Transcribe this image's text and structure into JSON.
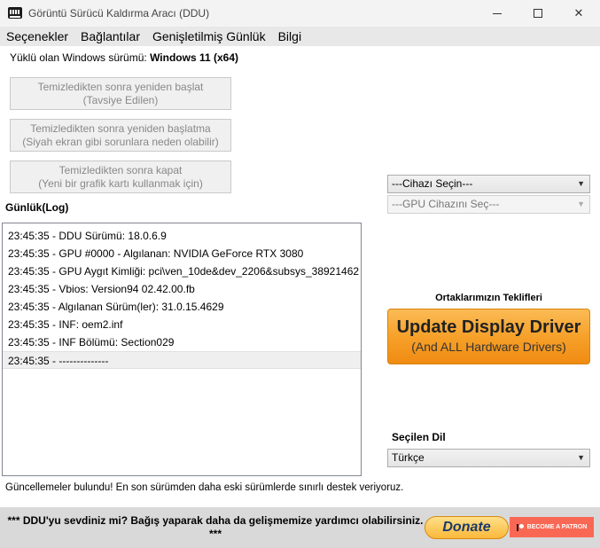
{
  "window": {
    "title": "Görüntü Sürücü Kaldırma Aracı (DDU)",
    "minimize_label": "",
    "maximize_label": "",
    "close_label": "✕"
  },
  "menu": [
    "Seçenekler",
    "Bağlantılar",
    "Genişletilmiş Günlük",
    "Bilgi"
  ],
  "os_info": {
    "label": "Yüklü olan Windows sürümü: ",
    "value": "Windows 11 (x64)"
  },
  "actions": [
    {
      "line1": "Temizledikten sonra yeniden başlat",
      "line2": "(Tavsiye Edilen)"
    },
    {
      "line1": "Temizledikten sonra yeniden başlatma",
      "line2": "(Siyah ekran gibi sorunlara neden olabilir)"
    },
    {
      "line1": "Temizledikten sonra kapat",
      "line2": "(Yeni bir grafik kartı kullanmak için)"
    }
  ],
  "log": {
    "title": "Günlük(Log)",
    "entries": [
      "23:45:35 - DDU Sürümü: 18.0.6.9",
      "23:45:35 - GPU #0000 - Algılanan: NVIDIA GeForce RTX 3080",
      "23:45:35 - GPU Aygıt Kimliği: pci\\ven_10de&dev_2206&subsys_38921462",
      "23:45:35 - Vbios: Version94 02.42.00.fb",
      "23:45:35 - Algılanan Sürüm(ler): 31.0.15.4629",
      "23:45:35 - INF: oem2.inf",
      "23:45:35 - INF Bölümü: Section029",
      "23:45:35 - --------------"
    ]
  },
  "device_select": {
    "value": "---Cihazı Seçin---"
  },
  "gpu_select": {
    "value": "---GPU Cihazını Seç---"
  },
  "partners": {
    "title": "Ortaklarımızın Teklifleri",
    "promo_main": "Update Display Driver",
    "promo_sub": "(And ALL Hardware Drivers)"
  },
  "language": {
    "title": "Seçilen Dil",
    "value": "Türkçe"
  },
  "status": "Güncellemeler bulundu! En son sürümden daha eski sürümlerde sınırlı destek veriyoruz.",
  "footer": {
    "text": "*** DDU'yu sevdiniz mi? Bağış yaparak daha da gelişmemize yardımcı olabilirsiniz. ***",
    "donate_label": "Donate",
    "patron_label": "BECOME A PATRON"
  }
}
